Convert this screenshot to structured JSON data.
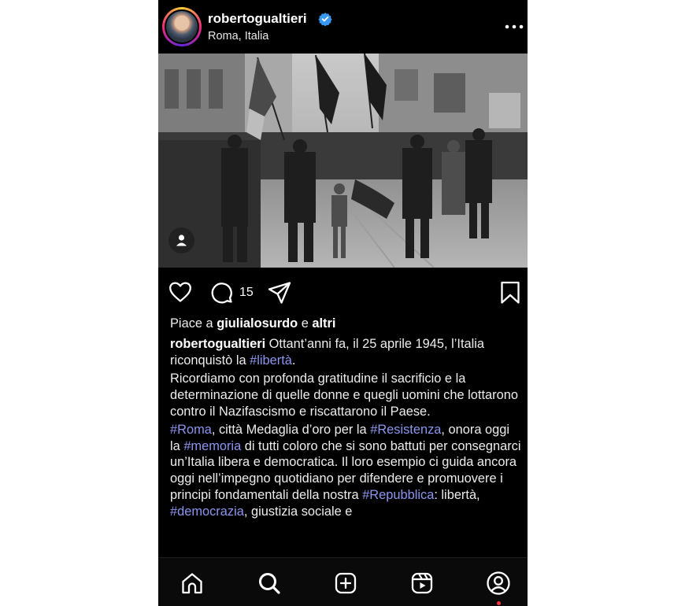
{
  "post": {
    "username": "robertogualtieri",
    "location": "Roma, Italia",
    "comment_count": "15"
  },
  "caption": {
    "likes_prefix": "Piace a ",
    "likes_user": "giulialosurdo",
    "likes_mid": " e ",
    "likes_suffix": "altri",
    "author": "robertogualtieri",
    "p1_text": " Ottant’anni fa, il 25 aprile 1945, l’Italia riconquistò la ",
    "p1_tag": "#libertà",
    "p1_end": ".",
    "p2": "Ricordiamo con profonda gratitudine il sacrificio e la determinazione di quelle donne e quegli uomini che lottarono contro il Nazifascismo e riscattarono il Paese.",
    "p3_tag1": "#Roma",
    "p3_t1": ", città Medaglia d’oro per la ",
    "p3_tag2": "#Resistenza",
    "p3_t2": ", onora oggi la ",
    "p3_tag3": "#memoria",
    "p3_t3": " di tutti coloro che si sono battuti per consegnarci un’Italia libera e democratica. Il loro esempio ci guida ancora oggi nell’impegno quotidiano per difendere e promuovere i principi fondamentali della nostra ",
    "p3_tag4": "#Repubblica",
    "p3_t4": ": libertà, ",
    "p3_tag5": "#democrazia",
    "p3_t5": ", giustizia sociale e"
  },
  "icons": {
    "verified": "verified-badge-icon",
    "more": "more-options-icon",
    "like": "heart-icon",
    "comment": "comment-icon",
    "share": "share-icon",
    "save": "bookmark-icon",
    "tag": "user-tag-icon",
    "nav": [
      "home-icon",
      "search-icon",
      "create-icon",
      "reels-icon",
      "profile-icon"
    ]
  },
  "colors": {
    "background": "#000000",
    "hashtag": "#8c95ee",
    "verified": "#3897f0",
    "notification": "#ff3040"
  }
}
